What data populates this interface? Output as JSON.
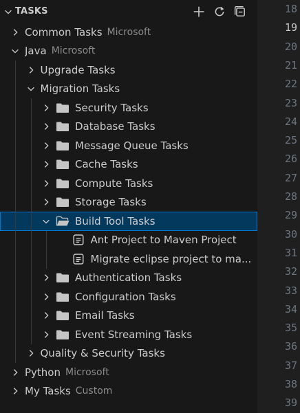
{
  "panel": {
    "title": "TASKS",
    "actions": [
      {
        "name": "add-task-button",
        "icon": "plus-icon"
      },
      {
        "name": "refresh-button",
        "icon": "refresh-icon"
      },
      {
        "name": "collapse-all-button",
        "icon": "collapse-all-icon"
      }
    ]
  },
  "tree": [
    {
      "depth": 0,
      "twisty": "right",
      "icon": "",
      "label": "Common Tasks",
      "desc": "Microsoft"
    },
    {
      "depth": 0,
      "twisty": "down",
      "icon": "",
      "label": "Java",
      "desc": "Microsoft"
    },
    {
      "depth": 1,
      "twisty": "right",
      "icon": "",
      "label": "Upgrade Tasks",
      "desc": ""
    },
    {
      "depth": 1,
      "twisty": "down",
      "icon": "",
      "label": "Migration Tasks",
      "desc": ""
    },
    {
      "depth": 2,
      "twisty": "right",
      "icon": "folder",
      "label": "Security Tasks",
      "desc": ""
    },
    {
      "depth": 2,
      "twisty": "right",
      "icon": "folder",
      "label": "Database Tasks",
      "desc": ""
    },
    {
      "depth": 2,
      "twisty": "right",
      "icon": "folder",
      "label": "Message Queue Tasks",
      "desc": ""
    },
    {
      "depth": 2,
      "twisty": "right",
      "icon": "folder",
      "label": "Cache Tasks",
      "desc": ""
    },
    {
      "depth": 2,
      "twisty": "right",
      "icon": "folder",
      "label": "Compute Tasks",
      "desc": ""
    },
    {
      "depth": 2,
      "twisty": "right",
      "icon": "folder",
      "label": "Storage Tasks",
      "desc": ""
    },
    {
      "depth": 2,
      "twisty": "down",
      "icon": "folder-open",
      "label": "Build Tool Tasks",
      "desc": "",
      "selected": true
    },
    {
      "depth": 3,
      "twisty": "none",
      "icon": "task",
      "label": "Ant Project to Maven Project",
      "desc": ""
    },
    {
      "depth": 3,
      "twisty": "none",
      "icon": "task",
      "label": "Migrate eclipse project to ma...",
      "desc": ""
    },
    {
      "depth": 2,
      "twisty": "right",
      "icon": "folder",
      "label": "Authentication Tasks",
      "desc": ""
    },
    {
      "depth": 2,
      "twisty": "right",
      "icon": "folder",
      "label": "Configuration Tasks",
      "desc": ""
    },
    {
      "depth": 2,
      "twisty": "right",
      "icon": "folder",
      "label": "Email Tasks",
      "desc": ""
    },
    {
      "depth": 2,
      "twisty": "right",
      "icon": "folder",
      "label": "Event Streaming Tasks",
      "desc": ""
    },
    {
      "depth": 1,
      "twisty": "right",
      "icon": "",
      "label": "Quality & Security Tasks",
      "desc": ""
    },
    {
      "depth": 0,
      "twisty": "right",
      "icon": "",
      "label": "Python",
      "desc": "Microsoft"
    },
    {
      "depth": 0,
      "twisty": "right",
      "icon": "",
      "label": "My Tasks",
      "desc": "Custom"
    }
  ],
  "gutter": {
    "lines": [
      "18",
      "19",
      "20",
      "21",
      "22",
      "23",
      "24",
      "25",
      "26",
      "27",
      "28",
      "29",
      "30",
      "31",
      "32",
      "33",
      "34",
      "35",
      "36",
      "37",
      "38",
      "39"
    ],
    "current": "19"
  },
  "colors": {
    "panel_bg": "#181818",
    "selected_bg": "#04395e",
    "selected_border": "#0078d4",
    "label": "#cccccc",
    "description": "#8b8b8b",
    "folder": "#c5c5c5"
  }
}
